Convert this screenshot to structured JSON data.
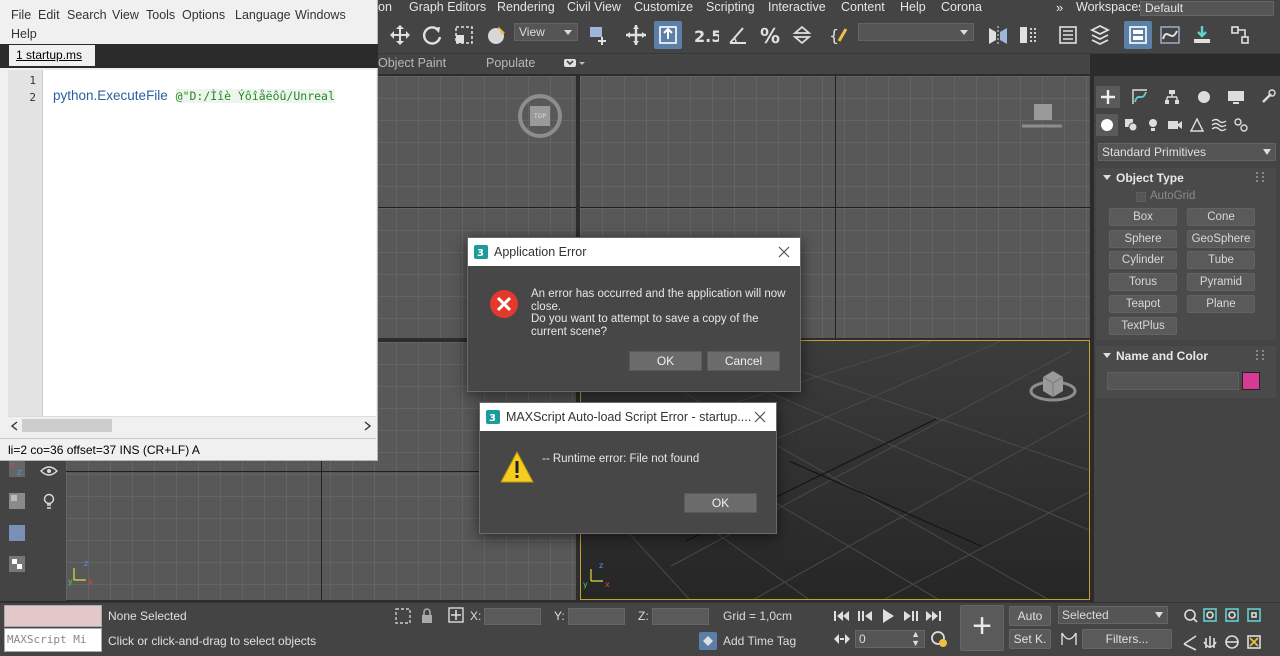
{
  "menubar": {
    "items": [
      "on",
      "Graph Editors",
      "Rendering",
      "Civil View",
      "Customize",
      "Scripting",
      "Interactive",
      "Content",
      "Help",
      "Corona"
    ],
    "workspaces_label": "Workspaces:",
    "workspace_value": "Default"
  },
  "toolbar": {
    "view_dropdown": "View",
    "snap_number": "2.5",
    "selection_set": ""
  },
  "ribbon": {
    "items": [
      "Object Paint",
      "Populate"
    ]
  },
  "command_panel": {
    "category": "Standard Primitives",
    "object_type_title": "Object Type",
    "autogrid_label": "AutoGrid",
    "buttons": [
      "Box",
      "Cone",
      "Sphere",
      "GeoSphere",
      "Cylinder",
      "Tube",
      "Torus",
      "Pyramid",
      "Teapot",
      "Plane",
      "TextPlus"
    ],
    "name_color_title": "Name and Color",
    "color_swatch": "#d63a96"
  },
  "viewports": {
    "accent_border": "#c8a030"
  },
  "status": {
    "selection": "None Selected",
    "hint": "Click or click-and-drag to select objects",
    "maxscript_mini": "MAXScript Mi",
    "x_label": "X:",
    "y_label": "Y:",
    "z_label": "Z:",
    "grid": "Grid = 1,0cm",
    "add_time_tag": "Add Time Tag",
    "frame": "0",
    "auto_key": "Auto",
    "set_key": "Set K.",
    "key_filter": "Selected",
    "filters": "Filters..."
  },
  "editor": {
    "menu": [
      "File",
      "Edit",
      "Search",
      "View",
      "Tools",
      "Options",
      "Language",
      "Windows",
      "Help"
    ],
    "tab": "1 startup.ms",
    "lines": [
      "1",
      "2"
    ],
    "code_fn": "python.ExecuteFile",
    "code_str": "@\"D:/Ìîè Ýôîåëôû/Unreal",
    "status": "li=2 co=36 offset=37 INS (CR+LF) A"
  },
  "app_error": {
    "title": "Application Error",
    "message": "An error has occurred and the application will now close.\nDo you want to attempt to save a copy of the current scene?",
    "ok": "OK",
    "cancel": "Cancel"
  },
  "script_error": {
    "title": "MAXScript Auto-load Script Error - startup....",
    "message": "-- Runtime error: File not found",
    "ok": "OK"
  }
}
